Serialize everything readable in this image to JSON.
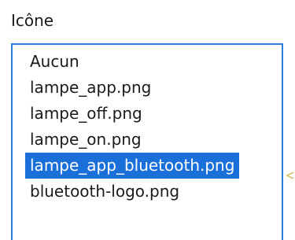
{
  "field": {
    "label": "Icône"
  },
  "icon_list": {
    "items": [
      {
        "label": "Aucun",
        "selected": false
      },
      {
        "label": "lampe_app.png",
        "selected": false
      },
      {
        "label": "lampe_off.png",
        "selected": false
      },
      {
        "label": "lampe_on.png",
        "selected": false
      },
      {
        "label": "lampe_app_bluetooth.png",
        "selected": true
      },
      {
        "label": "bluetooth-logo.png",
        "selected": false
      }
    ]
  },
  "colors": {
    "accent_border": "#2a7de1",
    "selection_bg": "#1a6fd8",
    "selection_text": "#ffffff",
    "text": "#1a1a1a",
    "pointer": "#d9b95a"
  },
  "icons": {
    "pointer": "arrow-left-icon"
  }
}
